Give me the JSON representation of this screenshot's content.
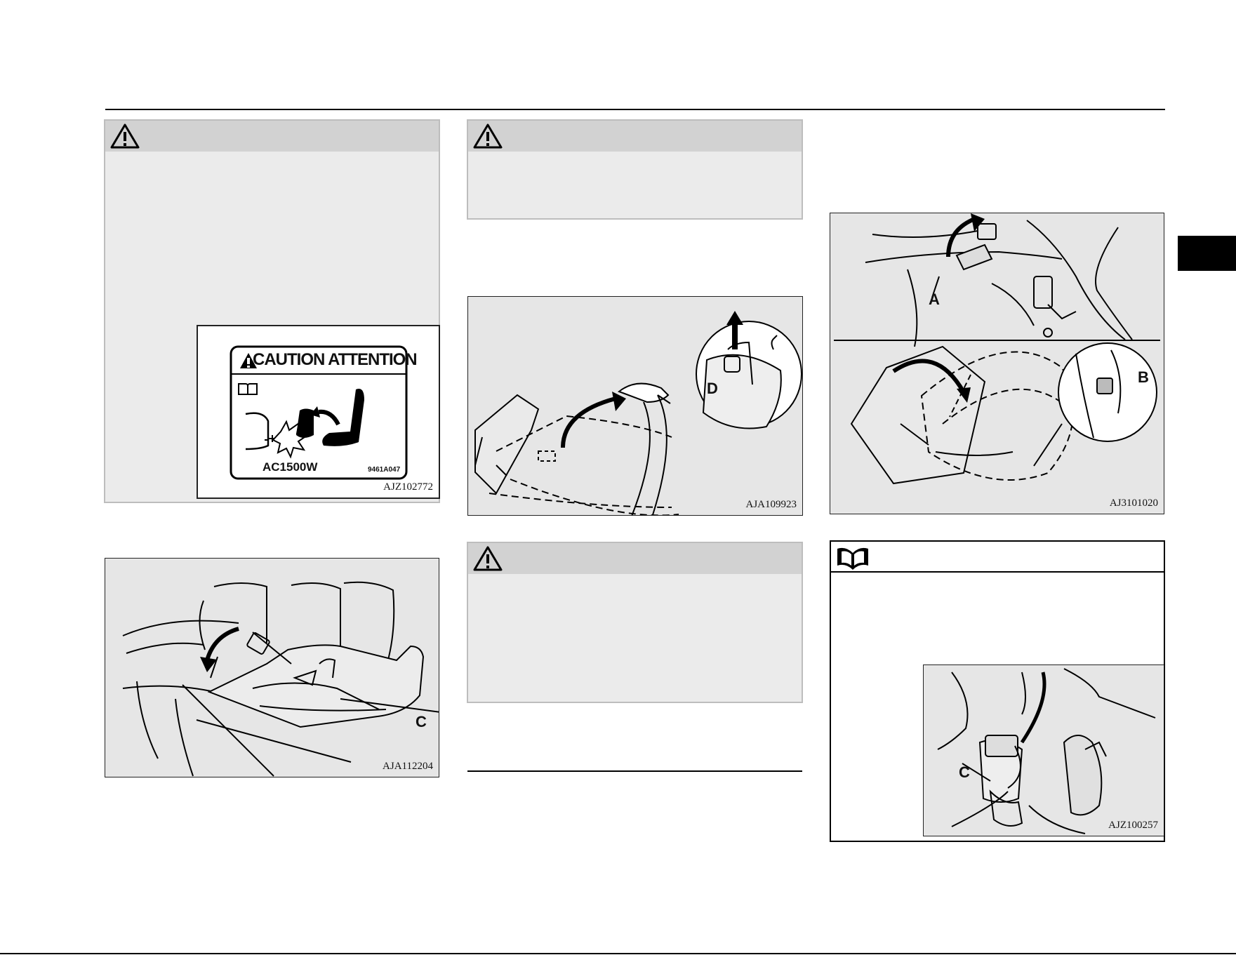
{
  "figures": {
    "caution_label": {
      "code": "AJZ102772",
      "label_title": "CAUTION ATTENTION",
      "label_power": "AC1500W",
      "label_part_no": "9461A047"
    },
    "seat_cushion": {
      "code": "AJA112204",
      "callout": "C"
    },
    "seatback_fold": {
      "code": "AJA109923",
      "callout": "D"
    },
    "seat_lever": {
      "code": "AJ3101020",
      "callout_a": "A",
      "callout_b": "B"
    },
    "seat_belt_buckle": {
      "code": "AJZ100257",
      "callout": "C"
    }
  },
  "colors": {
    "box_header": "#d2d2d2",
    "box_body": "#ebebeb",
    "figure_bg": "#e6e6e6",
    "page_tab": "#000000"
  },
  "icons": {
    "warning": "warning-triangle-icon",
    "note": "open-book-icon"
  }
}
